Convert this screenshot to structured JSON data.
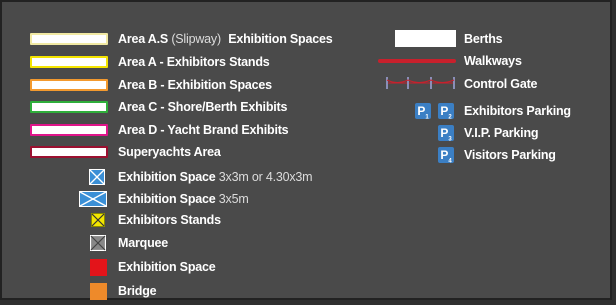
{
  "colors": {
    "background": "#4a4a4a",
    "area_as": "#f1e9a3",
    "area_a": "#f4e400",
    "area_b": "#f39a2f",
    "area_c": "#2fae3b",
    "area_d": "#e0148a",
    "superyachts": "#9b1030",
    "space_blue": "#3a8fd6",
    "stand_yellow": "#f2e500",
    "marquee_grey": "#888888",
    "exhibition_red": "#e3141a",
    "bridge_orange": "#ee8a2a",
    "walkway_red": "#c8202c",
    "parking_blue": "#3b7fc4"
  },
  "areas": [
    {
      "name": "Area A.S",
      "note": "(Slipway)",
      "desc": "Exhibition Spaces"
    },
    {
      "name": "Area A -",
      "desc": "Exhibitors Stands"
    },
    {
      "name": "Area B -",
      "desc": "Exhibition Spaces"
    },
    {
      "name": "Area C -",
      "desc": "Shore/Berth Exhibits"
    },
    {
      "name": "Area D -",
      "desc": "Yacht Brand Exhibits"
    },
    {
      "name": "Superyachts Area",
      "desc": ""
    }
  ],
  "symbols": [
    {
      "label": "Exhibition Space",
      "size": "3x3m or 4.30x3m",
      "icon": "blue-square-cross-icon"
    },
    {
      "label": "Exhibition Space",
      "size": "3x5m",
      "icon": "blue-rect-cross-icon"
    },
    {
      "label": "Exhibitors Stands",
      "size": "",
      "icon": "yellow-square-cross-icon"
    },
    {
      "label": "Marquee",
      "size": "",
      "icon": "grey-marquee-icon"
    },
    {
      "label": "Exhibition Space",
      "size": "",
      "icon": "red-square-icon"
    },
    {
      "label": "Bridge",
      "size": "",
      "icon": "orange-square-icon"
    }
  ],
  "right": {
    "berths": "Berths",
    "walkways": "Walkways",
    "control_gate": "Control Gate",
    "exhibitors_parking": "Exhibitors Parking",
    "vip_parking": "V.I.P. Parking",
    "visitors_parking": "Visitors Parking",
    "parking_letter": "P",
    "parking_numbers": [
      "1",
      "2",
      "3",
      "4"
    ]
  }
}
